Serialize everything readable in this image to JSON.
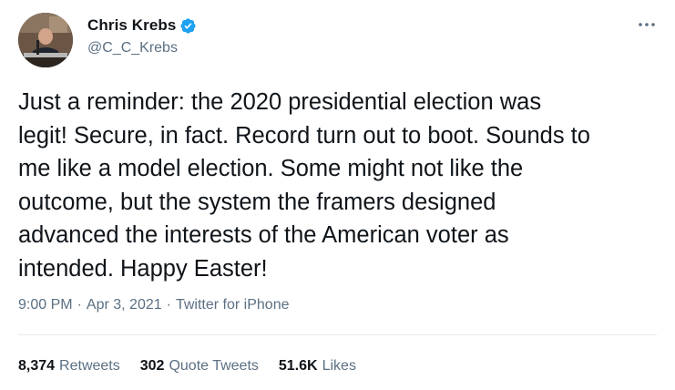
{
  "author": {
    "display_name": "Chris Krebs",
    "handle": "@C_C_Krebs",
    "verified": true
  },
  "tweet": {
    "lines": [
      "Just a reminder: the 2020 presidential election was",
      "legit! Secure, in fact. Record turn out to boot. Sounds to",
      "me like a model election. Some might not like the",
      "outcome, but the system the framers designed",
      "advanced the interests of the American voter as",
      "intended. Happy Easter!"
    ]
  },
  "meta": {
    "time": "9:00 PM",
    "separator": "·",
    "date": "Apr 3, 2021",
    "source": "Twitter for iPhone"
  },
  "stats": {
    "retweets_count": "8,374",
    "retweets_label": "Retweets",
    "quotes_count": "302",
    "quotes_label": "Quote Tweets",
    "likes_count": "51.6K",
    "likes_label": "Likes"
  },
  "colors": {
    "text": "#0f1419",
    "secondary": "#5b7083",
    "verified_blue": "#1da1f2",
    "divider": "#e6ecf0"
  },
  "icons": {
    "verified": "verified-badge-icon",
    "more": "more-options-icon"
  }
}
